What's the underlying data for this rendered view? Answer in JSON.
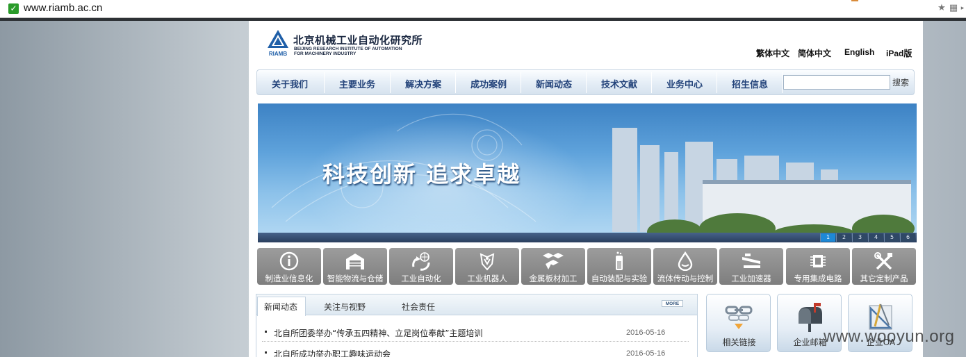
{
  "browser": {
    "url": "www.riamb.ac.cn",
    "icons": [
      "secure-check-icon",
      "bookmark-star-icon",
      "qr-code-icon"
    ]
  },
  "header": {
    "logo_mark_text": "RIAMB",
    "logo_cn": "北京机械工业自动化研究所",
    "logo_en_line1": "BEIJING RESEARCH INSTITUTE OF AUTOMATION",
    "logo_en_line2": "FOR MACHINERY INDUSTRY",
    "languages": [
      "繁体中文",
      "简体中文",
      "English",
      "iPad版"
    ]
  },
  "nav": {
    "items": [
      "关于我们",
      "主要业务",
      "解决方案",
      "成功案例",
      "新闻动态",
      "技术文献",
      "业务中心",
      "招生信息"
    ],
    "search_placeholder": "",
    "search_label": "搜索"
  },
  "banner": {
    "slogan": "科技创新  追求卓越",
    "pages": [
      "1",
      "2",
      "3",
      "4",
      "5",
      "6"
    ],
    "active_page": "1"
  },
  "categories": [
    {
      "label": "制造业信息化",
      "icon": "info-icon"
    },
    {
      "label": "智能物流与仓储",
      "icon": "warehouse-icon"
    },
    {
      "label": "工业自动化",
      "icon": "globe-arrows-icon"
    },
    {
      "label": "工业机器人",
      "icon": "robot-shield-icon"
    },
    {
      "label": "金属板材加工",
      "icon": "metal-sheets-icon"
    },
    {
      "label": "自动装配与实验",
      "icon": "test-tube-icon"
    },
    {
      "label": "流体传动与控制",
      "icon": "fluid-drop-icon"
    },
    {
      "label": "工业加速器",
      "icon": "accelerator-icon"
    },
    {
      "label": "专用集成电路",
      "icon": "chip-icon"
    },
    {
      "label": "其它定制产品",
      "icon": "tools-icon"
    }
  ],
  "news": {
    "tabs": [
      "新闻动态",
      "关注与视野",
      "社会责任"
    ],
    "active_tab": "新闻动态",
    "more": "MORE",
    "items": [
      {
        "title": "北自所团委举办“传承五四精神、立足岗位奉献”主题培训",
        "date": "2016-05-16"
      },
      {
        "title": "北自所成功举办职工趣味运动会",
        "date": "2016-05-16"
      }
    ]
  },
  "quick_links": [
    {
      "label": "相关链接",
      "icon": "link-chain-icon"
    },
    {
      "label": "企业邮箱",
      "icon": "mailbox-icon"
    },
    {
      "label": "企业OA",
      "icon": "drafting-tools-icon"
    }
  ],
  "watermark": "www.wooyun.org",
  "colors": {
    "nav_text": "#23437a",
    "tile_bg": "#8c8c8c",
    "pager_active": "#1e89d6"
  }
}
